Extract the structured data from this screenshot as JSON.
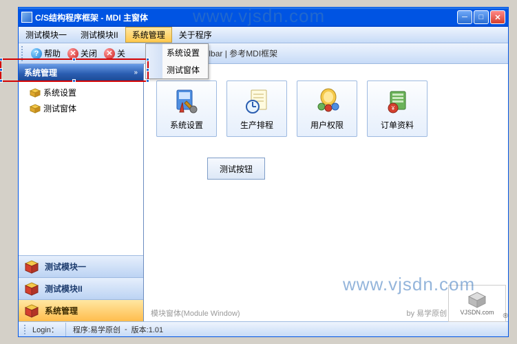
{
  "window": {
    "title": "C/S结构程序框架 - MDI 主窗体"
  },
  "menubar": {
    "items": [
      "测试模块一",
      "测试模块II",
      "系统管理",
      "关于程序"
    ],
    "dropdown": {
      "items": [
        "系统设置",
        "测试窗体"
      ]
    }
  },
  "toolbar": {
    "help": "帮助",
    "close": "关闭",
    "close_partial": "关",
    "tail": "oolbar | 参考MDI框架"
  },
  "nav": {
    "header": "系统管理",
    "tree": [
      "系统设置",
      "测试窗体"
    ],
    "modules": [
      "测试模块一",
      "测试模块II",
      "系统管理"
    ]
  },
  "cards": [
    {
      "label": "系统设置"
    },
    {
      "label": "生产排程"
    },
    {
      "label": "用户权限"
    },
    {
      "label": "订单资料"
    }
  ],
  "buttons": {
    "test": "测试按钮"
  },
  "footer": {
    "left": "模块窗体(Module Window)",
    "right": "by 易学原创 www.vjsdn.com"
  },
  "statusbar": {
    "login": "Login：",
    "program": "程序:易学原创",
    "version": "版本:1.01"
  },
  "watermark": "www.vjsdn.com",
  "logo": {
    "text": "VJSDN.com"
  }
}
